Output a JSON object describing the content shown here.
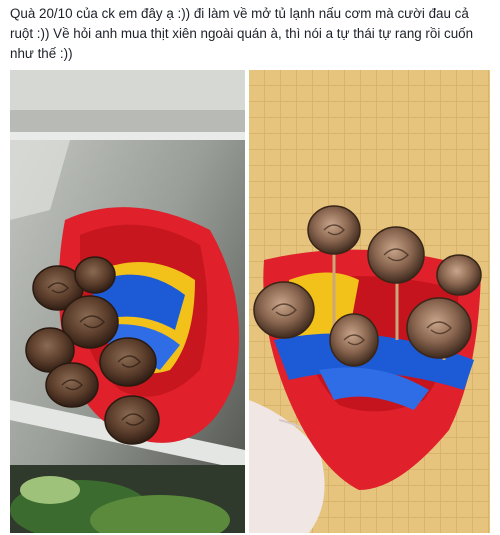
{
  "post": {
    "text": "Quà 20/10 của ck em đây ạ :)) đi làm về mở tủ lạnh nấu cơm mà cười đau cả ruột :)) Về hỏi anh mua thịt xiên ngoài quán à, thì nói a tự thái tự rang rồi cuốn như thế :))"
  },
  "photos": [
    {
      "name": "fridge-photo"
    },
    {
      "name": "held-bouquet-photo"
    }
  ],
  "colors": {
    "text": "#1d2129",
    "wrap_red": "#e0202b",
    "ribbon_blue": "#1d5bd6",
    "paper_yellow": "#f2c21b",
    "meat_brown": "#6b4a34",
    "tile": "#d9b46b"
  }
}
